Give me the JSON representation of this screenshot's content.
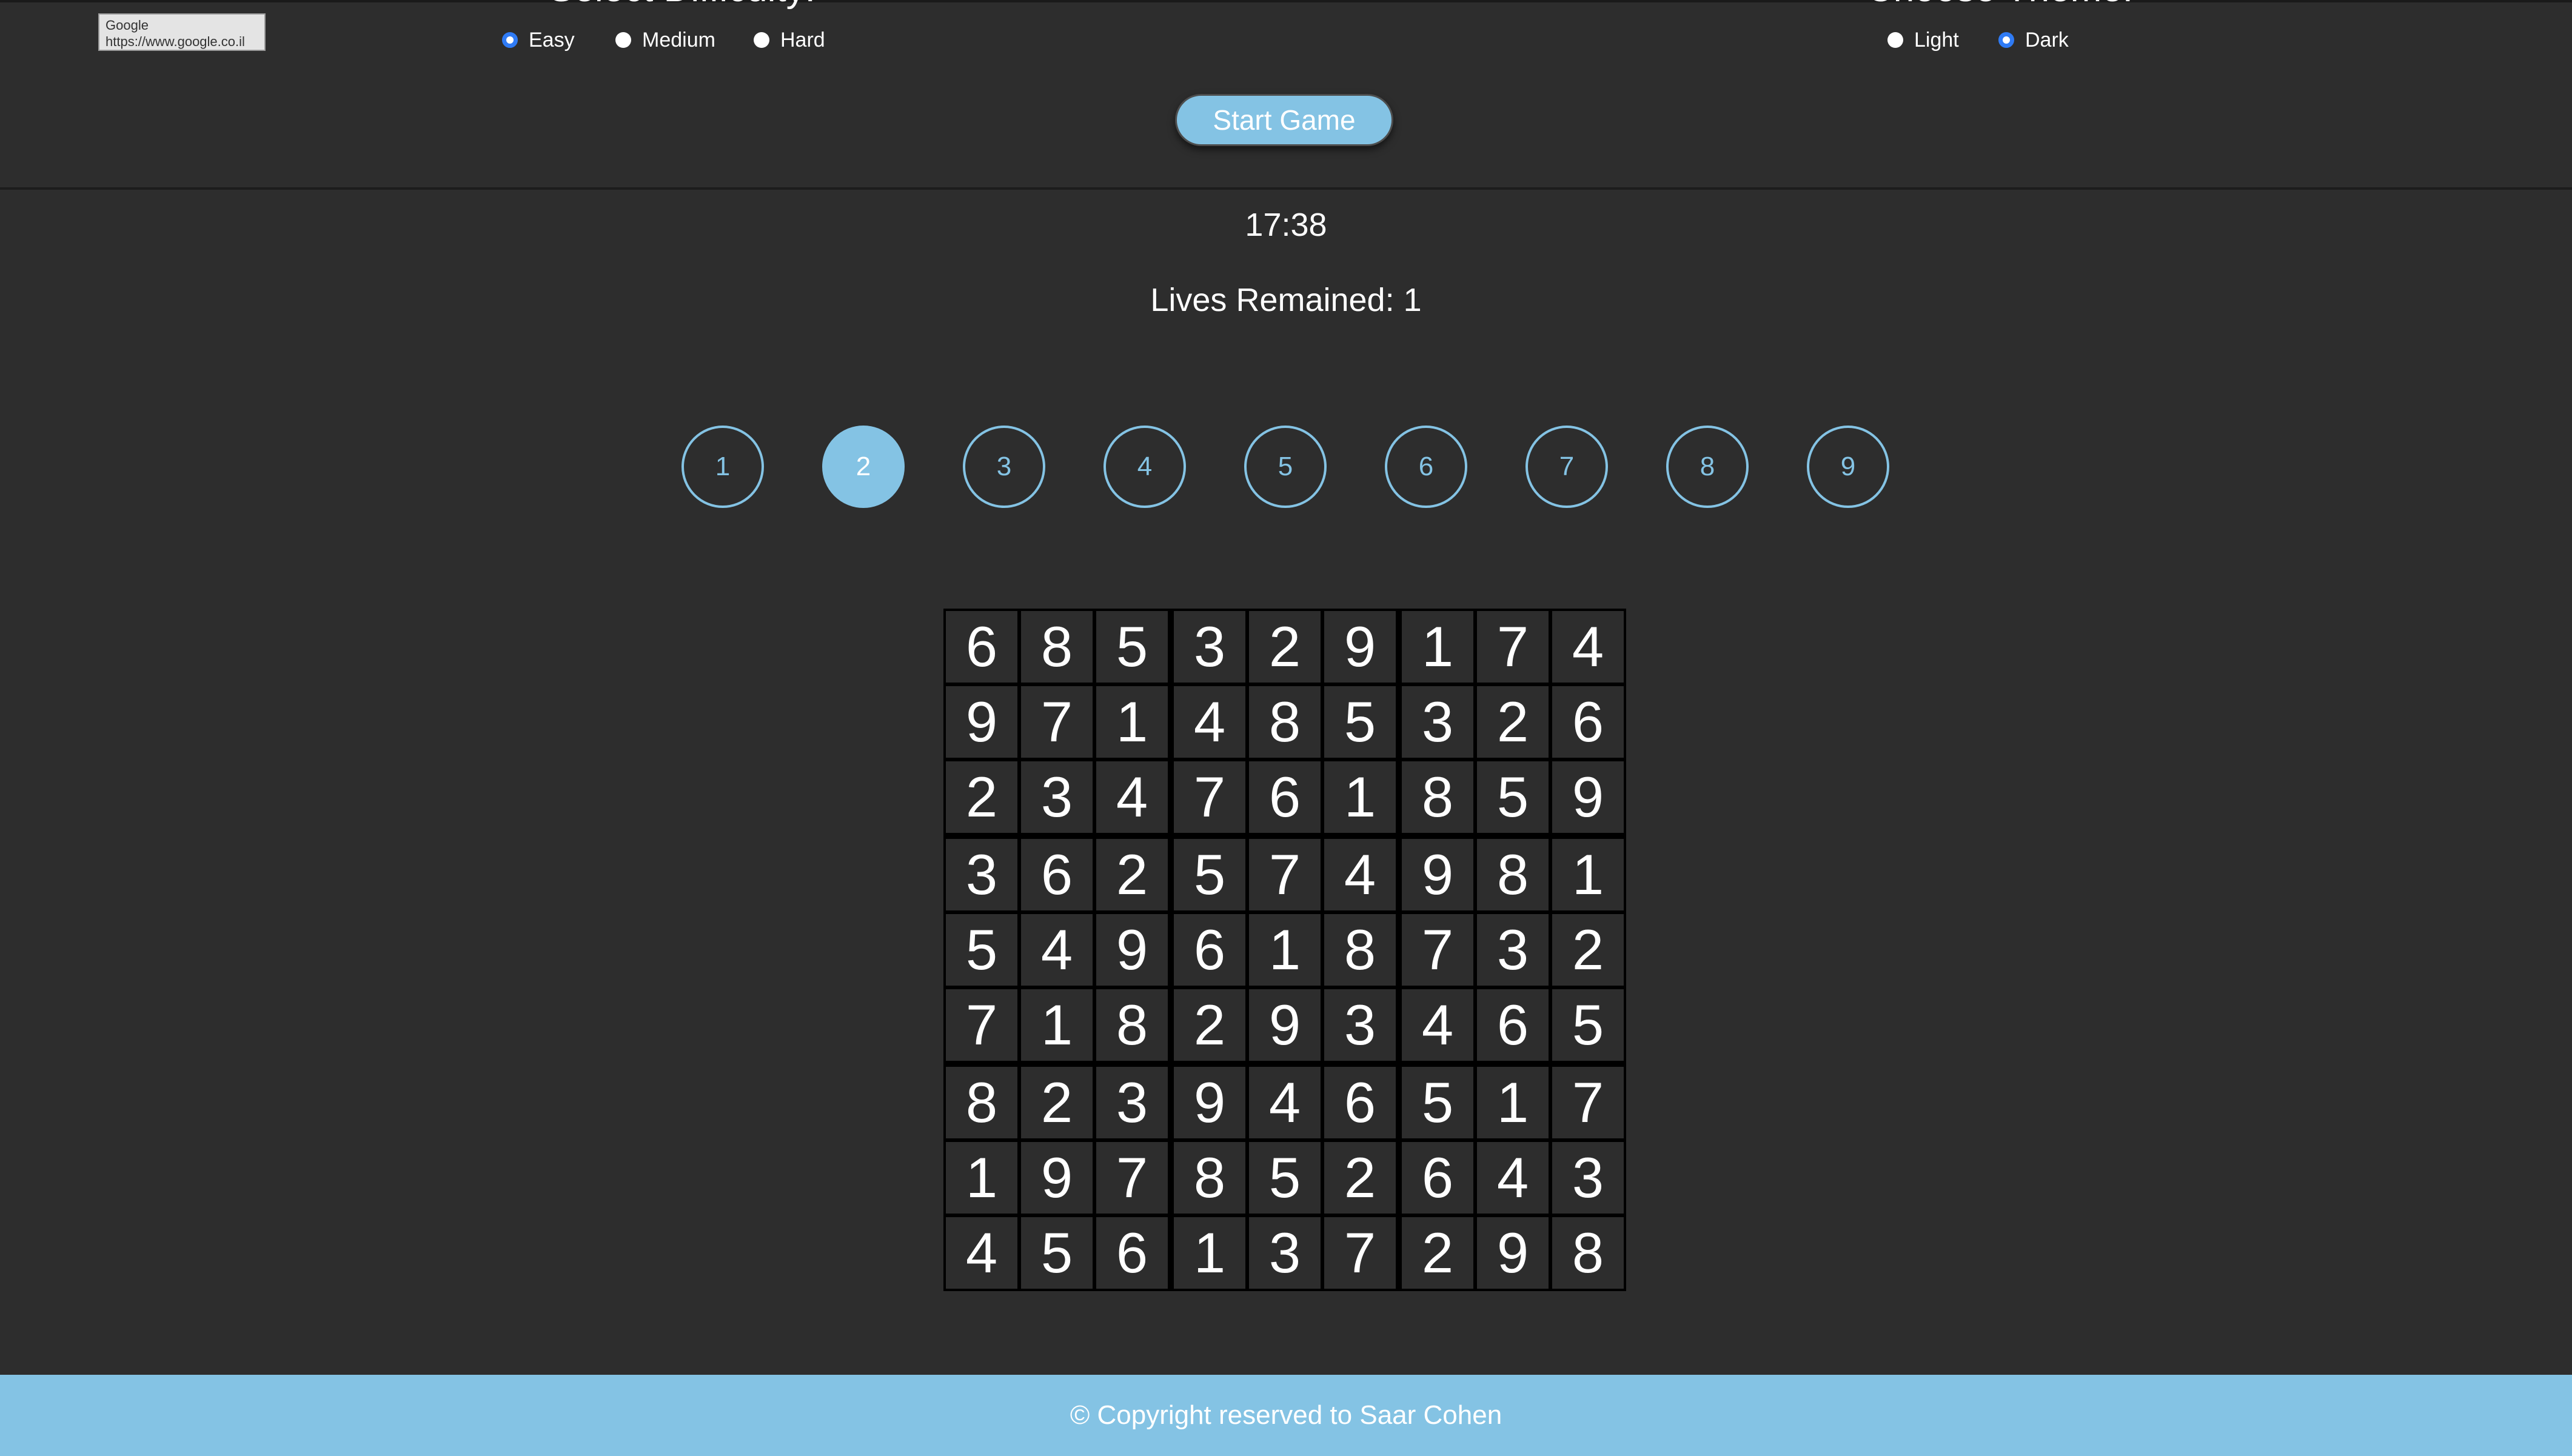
{
  "tooltip": {
    "title": "Google",
    "url": "https://www.google.co.il"
  },
  "settings": {
    "difficulty_heading": "Select Difficulty:",
    "theme_heading": "Choose Theme:",
    "difficulty_options": [
      {
        "label": "Easy",
        "checked": true
      },
      {
        "label": "Medium",
        "checked": false
      },
      {
        "label": "Hard",
        "checked": false
      }
    ],
    "theme_options": [
      {
        "label": "Light",
        "checked": false
      },
      {
        "label": "Dark",
        "checked": true
      }
    ]
  },
  "start_button_label": "Start Game",
  "status": {
    "timer": "17:38",
    "lives": "Lives Remained: 1"
  },
  "number_pad": {
    "numbers": [
      "1",
      "2",
      "3",
      "4",
      "5",
      "6",
      "7",
      "8",
      "9"
    ],
    "selected": "2"
  },
  "board": [
    [
      "6",
      "8",
      "5",
      "3",
      "2",
      "9",
      "1",
      "7",
      "4"
    ],
    [
      "9",
      "7",
      "1",
      "4",
      "8",
      "5",
      "3",
      "2",
      "6"
    ],
    [
      "2",
      "3",
      "4",
      "7",
      "6",
      "1",
      "8",
      "5",
      "9"
    ],
    [
      "3",
      "6",
      "2",
      "5",
      "7",
      "4",
      "9",
      "8",
      "1"
    ],
    [
      "5",
      "4",
      "9",
      "6",
      "1",
      "8",
      "7",
      "3",
      "2"
    ],
    [
      "7",
      "1",
      "8",
      "2",
      "9",
      "3",
      "4",
      "6",
      "5"
    ],
    [
      "8",
      "2",
      "3",
      "9",
      "4",
      "6",
      "5",
      "1",
      "7"
    ],
    [
      "1",
      "9",
      "7",
      "8",
      "5",
      "2",
      "6",
      "4",
      "3"
    ],
    [
      "4",
      "5",
      "6",
      "1",
      "3",
      "7",
      "2",
      "9",
      "8"
    ]
  ],
  "footer_text": "© Copyright reserved to Saar Cohen",
  "colors": {
    "background": "#2d2d2d",
    "accent": "#84c3e4",
    "radio_checked": "#2f7bf5"
  }
}
